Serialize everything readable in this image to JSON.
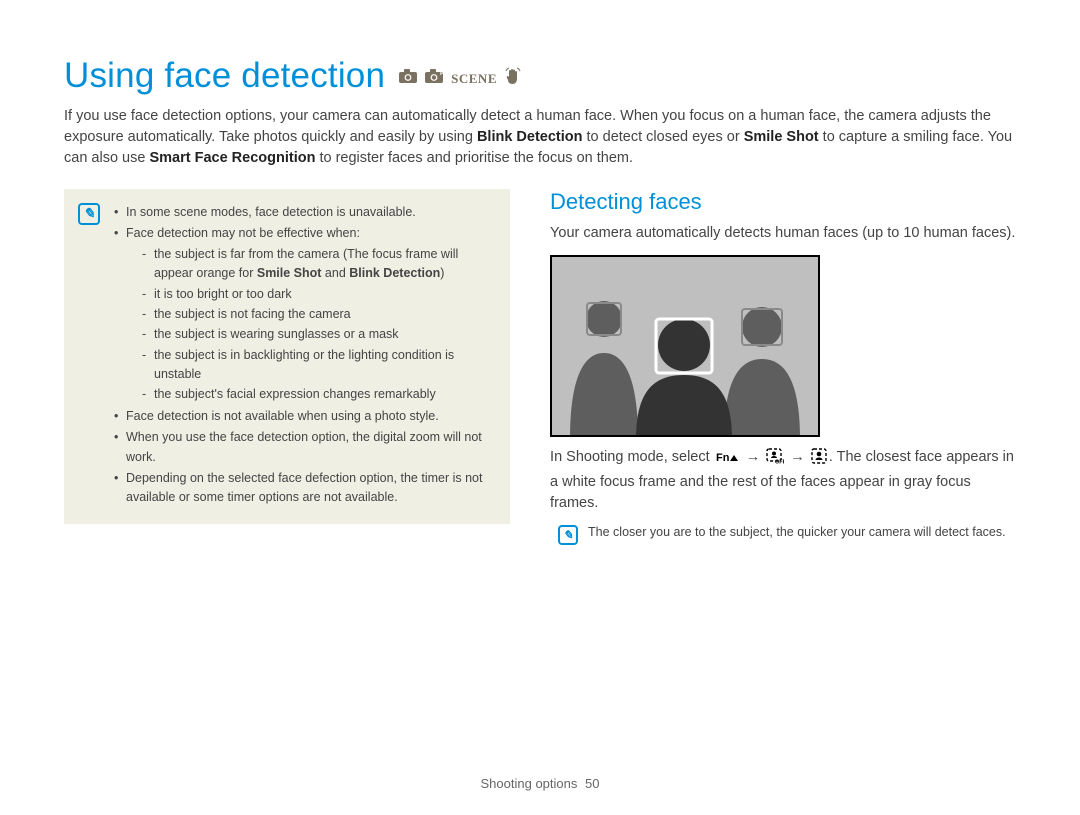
{
  "title": "Using face detection",
  "mode_icons": [
    "camera-icon",
    "camera-p-icon",
    "scene-icon",
    "hand-icon"
  ],
  "intro_segments": [
    {
      "t": "If you use face detection options, your camera can automatically detect a human face. When you focus on a human face, the camera adjusts the exposure automatically. Take photos quickly and easily by using "
    },
    {
      "t": "Blink Detection",
      "b": true
    },
    {
      "t": " to detect closed eyes or "
    },
    {
      "t": "Smile Shot",
      "b": true
    },
    {
      "t": " to capture a smiling face. You can also use "
    },
    {
      "t": "Smart Face Recognition",
      "b": true
    },
    {
      "t": " to register faces and prioritise the focus on them."
    }
  ],
  "notes": [
    {
      "text": "In some scene modes, face detection is unavailable."
    },
    {
      "text": "Face detection may not be effective when:",
      "sub": [
        {
          "pre": "the subject is far from the camera (The focus frame will appear orange for ",
          "bold1": "Smile Shot",
          "mid": " and ",
          "bold2": "Blink Detection",
          "post": ")"
        },
        {
          "text": "it is too bright or too dark"
        },
        {
          "text": "the subject is not facing the camera"
        },
        {
          "text": "the subject is wearing sunglasses or a mask"
        },
        {
          "text": "the subject is in backlighting or the lighting condition is unstable"
        },
        {
          "text": "the subject's facial expression changes remarkably"
        }
      ]
    },
    {
      "text": "Face detection is not available when using a photo style."
    },
    {
      "text": "When you use the face detection option, the digital zoom will not work."
    },
    {
      "text": "Depending on the selected face defection option, the timer is not available or some timer options are not available."
    }
  ],
  "right": {
    "subheading": "Detecting faces",
    "p1": "Your camera automatically detects human faces (up to 10 human faces).",
    "instr_pre": "In Shooting mode, select ",
    "instr_post": ". The closest face appears in a white focus frame and the rest of the faces appear in gray focus frames.",
    "tip": "The closer you are to the subject, the quicker your camera will detect faces."
  },
  "footer": {
    "section": "Shooting options",
    "page": "50"
  }
}
